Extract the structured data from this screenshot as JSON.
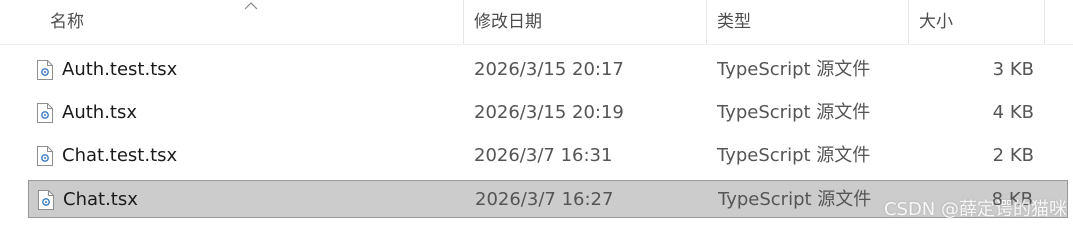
{
  "columns": {
    "name": "名称",
    "modified": "修改日期",
    "type": "类型",
    "size": "大小"
  },
  "files": [
    {
      "name": "Auth.test.tsx",
      "modified": "2026/3/15 20:17",
      "type": "TypeScript 源文件",
      "size": "3 KB",
      "icon": "tsx-file-icon",
      "selected": false
    },
    {
      "name": "Auth.tsx",
      "modified": "2026/3/15 20:19",
      "type": "TypeScript 源文件",
      "size": "4 KB",
      "icon": "tsx-file-icon",
      "selected": false
    },
    {
      "name": "Chat.test.tsx",
      "modified": "2026/3/7 16:31",
      "type": "TypeScript 源文件",
      "size": "2 KB",
      "icon": "tsx-file-icon",
      "selected": false
    },
    {
      "name": "Chat.tsx",
      "modified": "2026/3/7 16:27",
      "type": "TypeScript 源文件",
      "size": "8 KB",
      "icon": "tsx-file-icon",
      "selected": true
    }
  ],
  "watermark": "CSDN @薛定谔的猫咪",
  "colors": {
    "selection_bg": "#cccccc",
    "selection_border": "#9a9a9a",
    "icon_accent": "#3b7bbf"
  }
}
